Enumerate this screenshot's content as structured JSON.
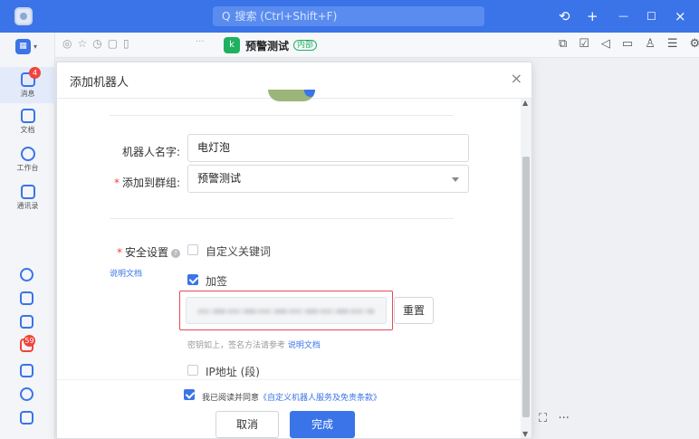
{
  "titlebar": {
    "search_placeholder": "搜索 (Ctrl+Shift+F)",
    "search_icon": "Q",
    "icons": {
      "history": "⟲",
      "add": "+",
      "minimize": "—",
      "maximize": "☐",
      "close": "×"
    }
  },
  "sidebar": {
    "items": [
      {
        "label": "消息",
        "badge": "4",
        "icon": "message-icon"
      },
      {
        "label": "文档",
        "icon": "doc-icon"
      },
      {
        "label": "工作台",
        "icon": "workbench-icon"
      },
      {
        "label": "通讯录",
        "icon": "contacts-icon"
      }
    ],
    "bottom_badge": "59"
  },
  "chat": {
    "group_name": "预警测试",
    "group_tag": "内部",
    "group_icon_text": "k"
  },
  "modal": {
    "title": "添加机器人",
    "close": "×",
    "robot_name_label": "机器人名字:",
    "robot_name_value": "电灯泡",
    "group_label": "添加到群组:",
    "group_value": "预警测试",
    "security_label": "安全设置",
    "help_mark": "?",
    "doc_link": "说明文档",
    "option_keyword": "自定义关键词",
    "option_sign": "加签",
    "reset_button": "重置",
    "hint_text": "密钥如上，签名方法请参考",
    "hint_link": "说明文档",
    "option_ip": "IP地址 (段)",
    "agree_prefix": "我已阅读并同意",
    "agree_link": "《自定义机器人服务及免责条款》",
    "cancel_button": "取消",
    "confirm_button": "完成",
    "checked": {
      "keyword": false,
      "sign": true,
      "ip": false,
      "agree": true
    }
  },
  "colors": {
    "accent": "#3a74e8",
    "required": "#f0443a",
    "highlight_border": "#e44a56"
  }
}
